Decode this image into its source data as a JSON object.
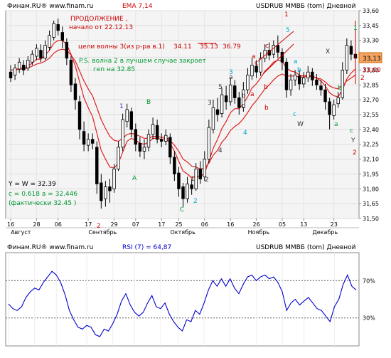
{
  "price_panel": {
    "header_left": "Финам.RU® www.finam.ru",
    "header_ema": "EMA 7,14",
    "header_right": "USDRUB ММВБ (tom) Дневной",
    "last_price_label": "33,13",
    "price_marker_label": "33,00",
    "y_ticks": [
      "33,60",
      "33,45",
      "33,30",
      "33,13",
      "33,00",
      "32,85",
      "32,70",
      "32,55",
      "32,40",
      "32,25",
      "32,10",
      "31,95",
      "31,80",
      "31,65",
      "31,50"
    ],
    "x_ticks": [
      "16",
      "28",
      "06",
      "17",
      "29",
      "07",
      "17",
      "25",
      "06",
      "16",
      "26",
      "05",
      "13",
      "23"
    ],
    "months": [
      "Август",
      "Сентябрь",
      "Октябрь",
      "Ноябрь",
      "Декабрь"
    ],
    "annotations": {
      "continuation_1": "ПРОДОЛЖЕНИЕ ,",
      "continuation_2": "начало от 22.12.13",
      "targets_prefix": "цели волны 3(из р-ра в.1)",
      "target_1": "34.11",
      "target_2": "35.13",
      "target_3": "36.79",
      "ps_1": "P.S. волна 2 в лучшем случае закроет",
      "ps_2": "геп на 32.85",
      "y_eq_w": "Y = W = 32.39",
      "c_eq": "c = 0.618 a = 32.446",
      "actual": "(фактически 32.45 )"
    },
    "wave_labels": [
      {
        "text": "1",
        "color": "#3333cc"
      },
      {
        "text": "B",
        "color": "#009933"
      },
      {
        "text": "A",
        "color": "#009933"
      },
      {
        "text": "2",
        "color": "#cc0000"
      },
      {
        "text": "C",
        "color": "#009933"
      },
      {
        "text": "2",
        "color": "#00aacc"
      },
      {
        "text": "1",
        "color": "#333333"
      },
      {
        "text": "2",
        "color": "#333333"
      },
      {
        "text": "3",
        "color": "#333333"
      },
      {
        "text": "4",
        "color": "#333333"
      },
      {
        "text": "5",
        "color": "#333333"
      },
      {
        "text": "a",
        "color": "#333333"
      },
      {
        "text": "b",
        "color": "#333333"
      },
      {
        "text": "c",
        "color": "#333333"
      },
      {
        "text": "a",
        "color": "#cc0000"
      },
      {
        "text": "b",
        "color": "#cc0000"
      },
      {
        "text": "c",
        "color": "#cc0000"
      },
      {
        "text": "3",
        "color": "#00aacc"
      },
      {
        "text": "4",
        "color": "#00aacc"
      },
      {
        "text": "5",
        "color": "#00aacc"
      },
      {
        "text": "c",
        "color": "#00aacc"
      },
      {
        "text": "a",
        "color": "#00aacc"
      },
      {
        "text": "b",
        "color": "#00aacc"
      },
      {
        "text": "W",
        "color": "#333333"
      },
      {
        "text": "1",
        "color": "#cc0000"
      },
      {
        "text": "X",
        "color": "#333333"
      },
      {
        "text": "a",
        "color": "#009933"
      },
      {
        "text": "b",
        "color": "#009933"
      },
      {
        "text": "c",
        "color": "#009933"
      },
      {
        "text": "Y",
        "color": "#333333"
      },
      {
        "text": "2",
        "color": "#cc0000"
      },
      {
        "text": "1",
        "color": "#009933"
      },
      {
        "text": "2",
        "color": "#cc0000"
      },
      {
        "text": "b",
        "color": "#cc0000"
      },
      {
        "text": "c",
        "color": "#cc0000"
      },
      {
        "text": "a",
        "color": "#cc0000"
      }
    ]
  },
  "rsi_panel": {
    "header_left": "Финам.RU® www.finam.ru",
    "header_rsi": "RSI (7) = 64,87",
    "header_right": "USDRUB ММВБ (tom) Дневной",
    "level_70": "70%",
    "level_30": "30%"
  },
  "colors": {
    "background": "#ffffff",
    "plot_bg": "#f4f4f4",
    "candle_up": "#ffffff",
    "candle_down": "#000000",
    "ema7": "#e02020",
    "ema14": "#e02020",
    "rsi_line": "#0000cc",
    "label_red": "#cc0000",
    "label_green": "#009933",
    "label_blue": "#3333cc",
    "label_cyan": "#00aacc",
    "price_box": "#f4a460"
  },
  "chart_data": [
    {
      "type": "candlestick",
      "title": "USDRUB ММВБ (tom) Дневной",
      "indicators": [
        "EMA 7",
        "EMA 14"
      ],
      "ylim": [
        31.5,
        33.6
      ],
      "y_unit": "RUB",
      "last_price": 33.13,
      "x_ticks": [
        "16",
        "28",
        "06",
        "17",
        "29",
        "07",
        "17",
        "25",
        "06",
        "16",
        "26",
        "05",
        "13",
        "23"
      ],
      "candles": [
        [
          32.98,
          32.92,
          33.05,
          32.88
        ],
        [
          32.95,
          33.02,
          33.06,
          32.9
        ],
        [
          33.01,
          33.08,
          33.12,
          32.97
        ],
        [
          33.05,
          33.0,
          33.1,
          32.95
        ],
        [
          33.02,
          33.1,
          33.14,
          32.99
        ],
        [
          33.08,
          33.16,
          33.2,
          33.05
        ],
        [
          33.14,
          33.22,
          33.26,
          33.1
        ],
        [
          33.2,
          33.12,
          33.26,
          33.08
        ],
        [
          33.12,
          33.25,
          33.3,
          33.1
        ],
        [
          33.23,
          33.35,
          33.4,
          33.2
        ],
        [
          33.33,
          33.47,
          33.5,
          33.3
        ],
        [
          33.46,
          33.4,
          33.52,
          33.35
        ],
        [
          33.38,
          33.3,
          33.44,
          33.22
        ],
        [
          33.28,
          33.12,
          33.32,
          33.05
        ],
        [
          33.1,
          32.85,
          33.14,
          32.78
        ],
        [
          32.86,
          32.7,
          32.92,
          32.6
        ],
        [
          32.68,
          32.4,
          32.74,
          32.3
        ],
        [
          32.38,
          32.25,
          32.48,
          32.18
        ],
        [
          32.24,
          32.3,
          32.36,
          32.18
        ],
        [
          32.3,
          32.26,
          32.36,
          32.2
        ],
        [
          32.22,
          31.85,
          32.28,
          31.75
        ],
        [
          31.86,
          31.68,
          31.95,
          31.6
        ],
        [
          31.7,
          31.82,
          31.88,
          31.62
        ],
        [
          31.82,
          31.78,
          31.9,
          31.66
        ],
        [
          31.8,
          32.0,
          32.05,
          31.76
        ],
        [
          32.0,
          32.22,
          32.28,
          31.98
        ],
        [
          32.22,
          32.5,
          32.56,
          32.18
        ],
        [
          32.48,
          32.6,
          32.66,
          32.42
        ],
        [
          32.58,
          32.4,
          32.62,
          32.32
        ],
        [
          32.4,
          32.25,
          32.46,
          32.18
        ],
        [
          32.26,
          32.18,
          32.32,
          32.12
        ],
        [
          32.18,
          32.22,
          32.3,
          32.1
        ],
        [
          32.22,
          32.35,
          32.4,
          32.18
        ],
        [
          32.35,
          32.45,
          32.52,
          32.3
        ],
        [
          32.44,
          32.3,
          32.5,
          32.26
        ],
        [
          32.3,
          32.28,
          32.36,
          32.22
        ],
        [
          32.28,
          32.34,
          32.4,
          32.24
        ],
        [
          32.32,
          32.12,
          32.36,
          32.05
        ],
        [
          32.12,
          31.95,
          32.18,
          31.88
        ],
        [
          31.96,
          31.8,
          32.02,
          31.72
        ],
        [
          31.82,
          31.7,
          31.86,
          31.62
        ],
        [
          31.7,
          31.85,
          31.92,
          31.66
        ],
        [
          31.84,
          31.8,
          31.9,
          31.74
        ],
        [
          31.8,
          32.0,
          32.06,
          31.78
        ],
        [
          32.0,
          31.9,
          32.08,
          31.85
        ],
        [
          31.92,
          32.1,
          32.18,
          31.88
        ],
        [
          32.1,
          32.42,
          32.5,
          32.06
        ],
        [
          32.4,
          32.62,
          32.7,
          32.36
        ],
        [
          32.6,
          32.55,
          32.72,
          32.48
        ],
        [
          32.56,
          32.75,
          32.82,
          32.52
        ],
        [
          32.74,
          32.68,
          32.84,
          32.6
        ],
        [
          32.68,
          32.85,
          32.92,
          32.64
        ],
        [
          32.84,
          32.72,
          32.9,
          32.66
        ],
        [
          32.72,
          32.62,
          32.78,
          32.55
        ],
        [
          32.62,
          32.8,
          32.88,
          32.58
        ],
        [
          32.8,
          32.95,
          33.02,
          32.76
        ],
        [
          32.94,
          33.05,
          33.12,
          32.9
        ],
        [
          33.04,
          32.98,
          33.1,
          32.92
        ],
        [
          32.98,
          33.12,
          33.18,
          32.94
        ],
        [
          33.12,
          33.2,
          33.26,
          33.08
        ],
        [
          33.2,
          33.15,
          33.28,
          33.1
        ],
        [
          33.16,
          33.25,
          33.3,
          33.12
        ],
        [
          33.25,
          33.18,
          33.35,
          33.12
        ],
        [
          33.18,
          33.08,
          33.22,
          33.0
        ],
        [
          33.08,
          32.8,
          33.12,
          32.72
        ],
        [
          32.8,
          32.9,
          32.96,
          32.74
        ],
        [
          32.9,
          32.95,
          33.0,
          32.84
        ],
        [
          32.94,
          32.86,
          33.0,
          32.8
        ],
        [
          32.86,
          32.92,
          32.98,
          32.82
        ],
        [
          32.92,
          32.98,
          33.04,
          32.88
        ],
        [
          32.98,
          32.9,
          33.02,
          32.84
        ],
        [
          32.9,
          32.85,
          32.96,
          32.8
        ],
        [
          32.84,
          32.8,
          32.9,
          32.74
        ],
        [
          32.8,
          32.68,
          32.86,
          32.6
        ],
        [
          32.68,
          32.55,
          32.72,
          32.4
        ],
        [
          32.54,
          32.65,
          32.7,
          32.5
        ],
        [
          32.66,
          32.72,
          32.78,
          32.62
        ],
        [
          32.72,
          33.0,
          33.08,
          32.7
        ],
        [
          33.0,
          33.25,
          33.32,
          32.96
        ],
        [
          33.24,
          33.16,
          33.3,
          33.1
        ],
        [
          33.16,
          33.12,
          33.22,
          33.05
        ]
      ],
      "ema7": [
        33.0,
        33.0,
        33.02,
        33.02,
        33.04,
        33.07,
        33.11,
        33.11,
        33.15,
        33.2,
        33.27,
        33.3,
        33.3,
        33.26,
        33.16,
        33.04,
        32.88,
        32.72,
        32.62,
        32.53,
        32.36,
        32.19,
        32.1,
        32.02,
        32.01,
        32.06,
        32.17,
        32.28,
        32.31,
        32.29,
        32.26,
        32.25,
        32.27,
        32.31,
        32.31,
        32.3,
        32.31,
        32.26,
        32.18,
        32.08,
        31.98,
        31.95,
        31.91,
        31.93,
        31.92,
        31.96,
        32.08,
        32.21,
        32.3,
        32.41,
        32.48,
        32.57,
        32.61,
        32.61,
        32.66,
        32.73,
        32.82,
        32.86,
        32.92,
        32.99,
        33.03,
        33.08,
        33.1,
        33.09,
        33.02,
        32.99,
        32.98,
        32.95,
        32.94,
        32.95,
        32.94,
        32.92,
        32.89,
        32.84,
        32.77,
        32.74,
        32.73,
        32.8,
        32.91,
        32.97,
        33.01
      ],
      "ema14": [
        33.0,
        33.0,
        33.01,
        33.01,
        33.02,
        33.04,
        33.06,
        33.07,
        33.09,
        33.12,
        33.17,
        33.2,
        33.21,
        33.2,
        33.15,
        33.09,
        32.99,
        32.89,
        32.81,
        32.74,
        32.62,
        32.5,
        32.41,
        32.33,
        32.29,
        32.28,
        32.31,
        32.35,
        32.36,
        32.35,
        32.33,
        32.31,
        32.31,
        32.33,
        32.33,
        32.32,
        32.32,
        32.29,
        32.24,
        32.18,
        32.1,
        32.07,
        32.03,
        32.02,
        32.0,
        32.01,
        32.06,
        32.14,
        32.19,
        32.27,
        32.32,
        32.39,
        32.43,
        32.46,
        32.51,
        32.57,
        32.64,
        32.69,
        32.75,
        32.81,
        32.85,
        32.9,
        32.94,
        32.96,
        32.94,
        32.94,
        32.94,
        32.93,
        32.93,
        32.94,
        32.93,
        32.92,
        32.91,
        32.88,
        32.84,
        32.82,
        32.81,
        32.84,
        32.89,
        32.92,
        32.95
      ]
    },
    {
      "type": "line",
      "title": "RSI (7) = 64,87",
      "ylim": [
        0,
        100
      ],
      "levels": [
        30,
        70
      ],
      "values": [
        45,
        40,
        38,
        42,
        52,
        58,
        62,
        60,
        68,
        74,
        80,
        76,
        68,
        55,
        38,
        28,
        20,
        18,
        22,
        20,
        12,
        10,
        18,
        16,
        24,
        34,
        48,
        56,
        44,
        36,
        32,
        36,
        46,
        54,
        42,
        40,
        46,
        34,
        26,
        20,
        16,
        28,
        26,
        38,
        34,
        46,
        60,
        70,
        64,
        72,
        64,
        72,
        62,
        56,
        66,
        74,
        76,
        70,
        74,
        76,
        72,
        74,
        68,
        58,
        38,
        46,
        50,
        44,
        48,
        52,
        46,
        40,
        38,
        32,
        26,
        42,
        50,
        66,
        76,
        64,
        60
      ]
    }
  ]
}
